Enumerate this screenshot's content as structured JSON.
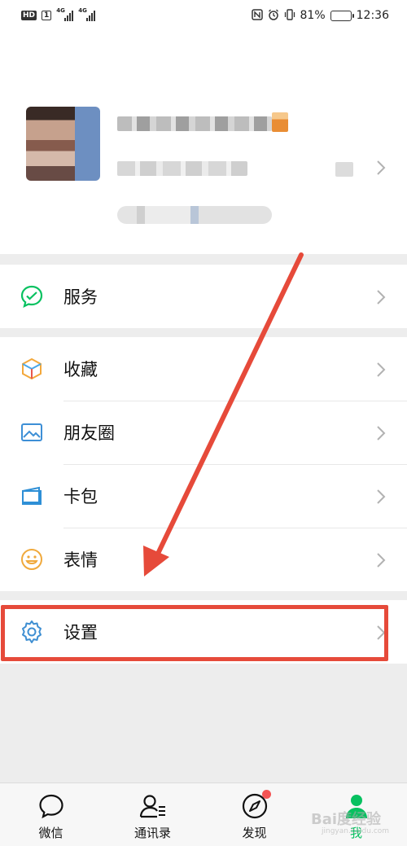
{
  "status_bar": {
    "hd": "HD",
    "sim": "1",
    "net1": "4G",
    "net2": "4G",
    "battery_percent": "81%",
    "battery_level": 0.81,
    "time": "12:36"
  },
  "profile": {
    "avatar": "avatar-image",
    "name": "",
    "wechat_id": "",
    "status": ""
  },
  "menu": {
    "services": {
      "label": "服务",
      "icon": "services-icon"
    },
    "favorites": {
      "label": "收藏",
      "icon": "favorites-cube-icon"
    },
    "moments": {
      "label": "朋友圈",
      "icon": "moments-image-icon"
    },
    "cards": {
      "label": "卡包",
      "icon": "card-wallet-icon"
    },
    "stickers": {
      "label": "表情",
      "icon": "sticker-smile-icon"
    },
    "settings": {
      "label": "设置",
      "icon": "gear-icon"
    }
  },
  "tabbar": {
    "chats": {
      "label": "微信"
    },
    "contacts": {
      "label": "通讯录"
    },
    "discover": {
      "label": "发现"
    },
    "me": {
      "label": "我"
    }
  },
  "colors": {
    "accent_green": "#07c160",
    "annotation_red": "#e64a3a",
    "background": "#ededed"
  },
  "watermark": {
    "text": "Bai度经验",
    "sub": "jingyan.baidu.com"
  }
}
